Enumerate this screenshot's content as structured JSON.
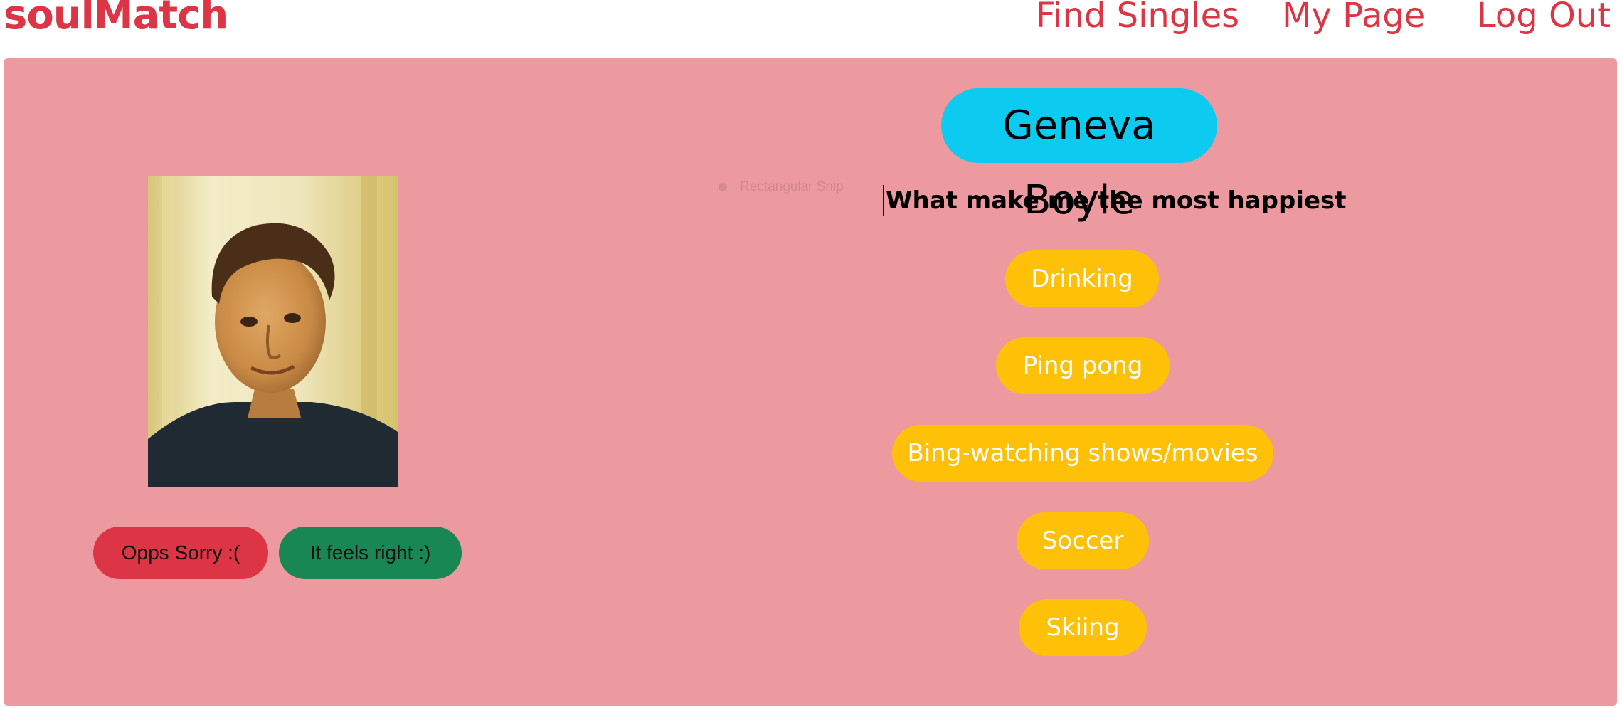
{
  "nav": {
    "brand": "soulMatch",
    "links": [
      "Find Singles",
      "My Page",
      "Log Out"
    ]
  },
  "profile": {
    "name": "Geneva Boyle",
    "photo_alt": "profile-photo",
    "section_title": "What make me the most happiest",
    "interests": [
      "Drinking",
      "Ping pong",
      "Bing-watching shows/movies",
      "Soccer",
      "Skiing"
    ]
  },
  "actions": {
    "reject_label": "Opps Sorry :(",
    "accept_label": "It feels right :)"
  },
  "overlay": {
    "snip_label": "Rectangular Snip"
  },
  "colors": {
    "brand": "#dc3545",
    "card_bg": "#ec9aa0",
    "name_pill": "#0dcaf0",
    "interest_pill": "#ffc107",
    "reject": "#dc3545",
    "accept": "#198754"
  }
}
